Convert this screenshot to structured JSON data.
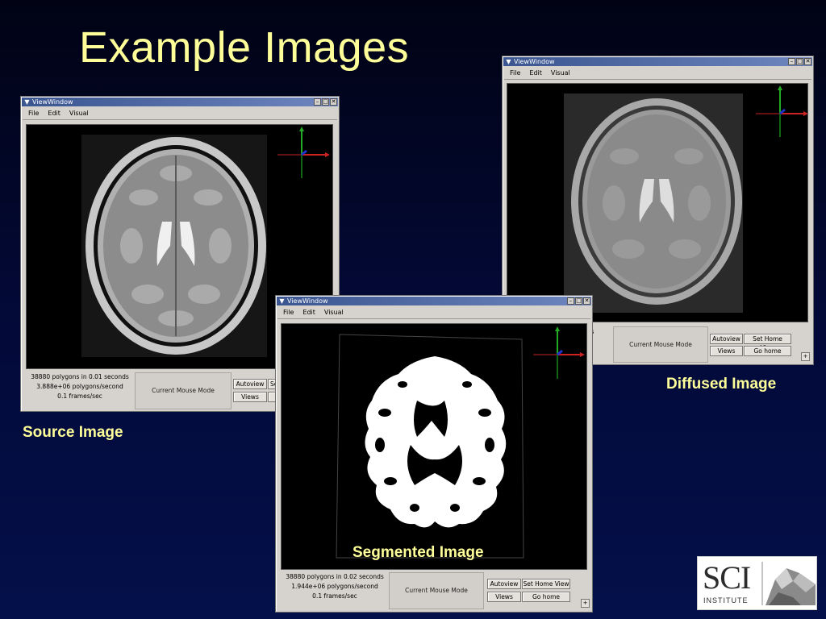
{
  "slide": {
    "title": "Example Images",
    "captions": {
      "source": "Source Image",
      "diffused": "Diffused Image",
      "segmented": "Segmented Image"
    }
  },
  "window_common": {
    "title": "ViewWindow",
    "menu": {
      "file": "File",
      "edit": "Edit",
      "visual": "Visual"
    },
    "buttons": {
      "autoview": "Autoview",
      "set_home_view": "Set Home View",
      "views": "Views",
      "go_home": "Go home"
    },
    "mouse_mode": "Current Mouse Mode",
    "corner_button": "+"
  },
  "windows": {
    "source": {
      "status_line1": "38880 polygons in 0.01 seconds",
      "status_line2": "3.888e+06 polygons/second",
      "status_line3": "0.1 frames/sec",
      "set_home_view_visible": "Se"
    },
    "diffused": {
      "status_line1": "nds",
      "status_line2": "d"
    },
    "segmented": {
      "status_line1": "38880 polygons in 0.02 seconds",
      "status_line2": "1.944e+06 polygons/second",
      "status_line3": "0.1 frames/sec"
    }
  },
  "logo": {
    "text": "SCI",
    "subtext": "INSTITUTE"
  },
  "colors": {
    "background": "#02082a",
    "title_text": "#ffff99",
    "window_face": "#d6d3ce",
    "titlebar": "#4a64a0",
    "axis_x": "#cc2222",
    "axis_y": "#22aa22",
    "axis_z": "#2233cc"
  },
  "icons": {
    "window_menu": "chevron-down-icon",
    "minimize": "minimize-icon",
    "maximize": "maximize-icon",
    "close": "close-icon",
    "axes": "xyz-axes-icon"
  }
}
